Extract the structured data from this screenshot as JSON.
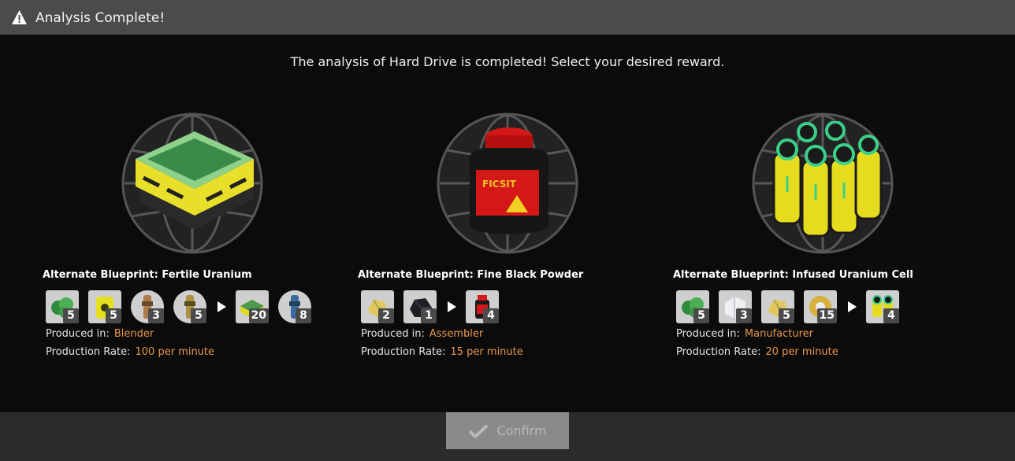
{
  "dialog": {
    "title": "Analysis Complete!",
    "message": "The analysis of Hard Drive is completed! Select your desired reward."
  },
  "rewards": [
    {
      "title": "Alternate Blueprint: Fertile Uranium",
      "image_icon": "fertile-uranium-icon",
      "inputs": [
        {
          "icon": "uranium-ore-icon",
          "count": "5"
        },
        {
          "icon": "uranium-waste-icon",
          "count": "5"
        },
        {
          "icon": "nitric-acid-icon",
          "count": "3"
        },
        {
          "icon": "sulfuric-acid-icon",
          "count": "5"
        }
      ],
      "outputs": [
        {
          "icon": "non-fissile-uranium-icon",
          "count": "20"
        },
        {
          "icon": "water-icon",
          "count": "8"
        }
      ],
      "produced_in_label": "Produced in:",
      "produced_in": "Blender",
      "rate_label": "Production Rate:",
      "rate": "100 per minute"
    },
    {
      "title": "Alternate Blueprint: Fine Black Powder",
      "image_icon": "black-powder-icon",
      "inputs": [
        {
          "icon": "sulfur-icon",
          "count": "2"
        },
        {
          "icon": "compacted-coal-icon",
          "count": "1"
        }
      ],
      "outputs": [
        {
          "icon": "black-powder-icon",
          "count": "4"
        }
      ],
      "produced_in_label": "Produced in:",
      "produced_in": "Assembler",
      "rate_label": "Production Rate:",
      "rate": "15 per minute"
    },
    {
      "title": "Alternate Blueprint: Infused Uranium Cell",
      "image_icon": "encased-uranium-cell-icon",
      "inputs": [
        {
          "icon": "uranium-ore-icon",
          "count": "5"
        },
        {
          "icon": "silica-icon",
          "count": "3"
        },
        {
          "icon": "sulfur-icon",
          "count": "5"
        },
        {
          "icon": "quickwire-icon",
          "count": "15"
        }
      ],
      "outputs": [
        {
          "icon": "encased-uranium-cell-icon",
          "count": "4"
        }
      ],
      "produced_in_label": "Produced in:",
      "produced_in": "Manufacturer",
      "rate_label": "Production Rate:",
      "rate": "20 per minute"
    }
  ],
  "confirm_label": "Confirm",
  "colors": {
    "accent": "#e8964a",
    "panel": "#0a0a0a",
    "titlebar": "#4b4b4b",
    "confirm_disabled": "#8a8a8a"
  }
}
